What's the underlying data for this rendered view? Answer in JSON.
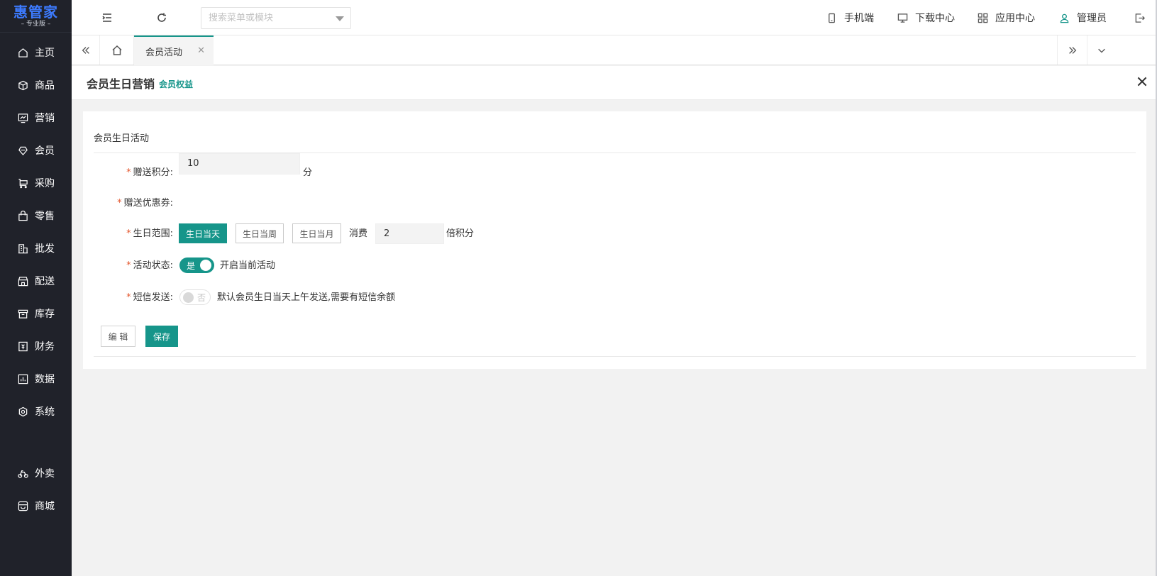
{
  "sidebar": {
    "logo_main": "惠管家",
    "logo_sub": "– 专业版 –",
    "items": [
      {
        "label": "主页",
        "icon": "home-icon"
      },
      {
        "label": "商品",
        "icon": "box-icon"
      },
      {
        "label": "营销",
        "icon": "chart-icon"
      },
      {
        "label": "会员",
        "icon": "diamond-icon"
      },
      {
        "label": "采购",
        "icon": "cart-icon"
      },
      {
        "label": "零售",
        "icon": "bag-icon"
      },
      {
        "label": "批发",
        "icon": "building-icon"
      },
      {
        "label": "配送",
        "icon": "store-icon"
      },
      {
        "label": "库存",
        "icon": "warehouse-icon"
      },
      {
        "label": "财务",
        "icon": "finance-icon"
      },
      {
        "label": "数据",
        "icon": "bar-chart-icon"
      },
      {
        "label": "系统",
        "icon": "settings-icon"
      },
      {
        "label": "外卖",
        "icon": "bike-icon"
      },
      {
        "label": "商城",
        "icon": "shop-icon"
      }
    ]
  },
  "header": {
    "search_placeholder": "搜索菜单或模块",
    "mobile": "手机端",
    "download": "下载中心",
    "apps": "应用中心",
    "user": "管理员"
  },
  "tabs": {
    "active": "会员活动"
  },
  "panel": {
    "title": "会员生日营销",
    "tag": "会员权益"
  },
  "form": {
    "section_title": "会员生日活动",
    "points_label": "赠送积分:",
    "points_value": "10",
    "points_unit": "分",
    "coupon_label": "赠送优惠券:",
    "range_label": "生日范围:",
    "range_options": [
      "生日当天",
      "生日当周",
      "生日当月"
    ],
    "range_selected": "生日当天",
    "consume_label": "消费",
    "multiplier_value": "2",
    "multiplier_unit": "倍积分",
    "status_label": "活动状态:",
    "status_switch": "是",
    "status_desc": "开启当前活动",
    "sms_label": "短信发送:",
    "sms_switch": "否",
    "sms_desc": "默认会员生日当天上午发送,需要有短信余额",
    "edit_btn": "编 辑",
    "save_btn": "保存"
  },
  "colors": {
    "accent": "#16958a",
    "sidebar_bg": "#20222a",
    "logo": "#3d7bff",
    "required": "#e4572e"
  }
}
